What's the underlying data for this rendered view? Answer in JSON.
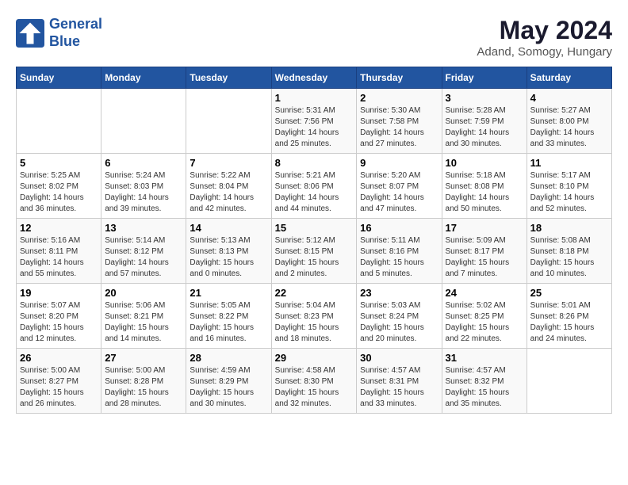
{
  "logo": {
    "line1": "General",
    "line2": "Blue"
  },
  "title": "May 2024",
  "subtitle": "Adand, Somogy, Hungary",
  "days_of_week": [
    "Sunday",
    "Monday",
    "Tuesday",
    "Wednesday",
    "Thursday",
    "Friday",
    "Saturday"
  ],
  "weeks": [
    [
      {
        "day": "",
        "info": ""
      },
      {
        "day": "",
        "info": ""
      },
      {
        "day": "",
        "info": ""
      },
      {
        "day": "1",
        "info": "Sunrise: 5:31 AM\nSunset: 7:56 PM\nDaylight: 14 hours and 25 minutes."
      },
      {
        "day": "2",
        "info": "Sunrise: 5:30 AM\nSunset: 7:58 PM\nDaylight: 14 hours and 27 minutes."
      },
      {
        "day": "3",
        "info": "Sunrise: 5:28 AM\nSunset: 7:59 PM\nDaylight: 14 hours and 30 minutes."
      },
      {
        "day": "4",
        "info": "Sunrise: 5:27 AM\nSunset: 8:00 PM\nDaylight: 14 hours and 33 minutes."
      }
    ],
    [
      {
        "day": "5",
        "info": "Sunrise: 5:25 AM\nSunset: 8:02 PM\nDaylight: 14 hours and 36 minutes."
      },
      {
        "day": "6",
        "info": "Sunrise: 5:24 AM\nSunset: 8:03 PM\nDaylight: 14 hours and 39 minutes."
      },
      {
        "day": "7",
        "info": "Sunrise: 5:22 AM\nSunset: 8:04 PM\nDaylight: 14 hours and 42 minutes."
      },
      {
        "day": "8",
        "info": "Sunrise: 5:21 AM\nSunset: 8:06 PM\nDaylight: 14 hours and 44 minutes."
      },
      {
        "day": "9",
        "info": "Sunrise: 5:20 AM\nSunset: 8:07 PM\nDaylight: 14 hours and 47 minutes."
      },
      {
        "day": "10",
        "info": "Sunrise: 5:18 AM\nSunset: 8:08 PM\nDaylight: 14 hours and 50 minutes."
      },
      {
        "day": "11",
        "info": "Sunrise: 5:17 AM\nSunset: 8:10 PM\nDaylight: 14 hours and 52 minutes."
      }
    ],
    [
      {
        "day": "12",
        "info": "Sunrise: 5:16 AM\nSunset: 8:11 PM\nDaylight: 14 hours and 55 minutes."
      },
      {
        "day": "13",
        "info": "Sunrise: 5:14 AM\nSunset: 8:12 PM\nDaylight: 14 hours and 57 minutes."
      },
      {
        "day": "14",
        "info": "Sunrise: 5:13 AM\nSunset: 8:13 PM\nDaylight: 15 hours and 0 minutes."
      },
      {
        "day": "15",
        "info": "Sunrise: 5:12 AM\nSunset: 8:15 PM\nDaylight: 15 hours and 2 minutes."
      },
      {
        "day": "16",
        "info": "Sunrise: 5:11 AM\nSunset: 8:16 PM\nDaylight: 15 hours and 5 minutes."
      },
      {
        "day": "17",
        "info": "Sunrise: 5:09 AM\nSunset: 8:17 PM\nDaylight: 15 hours and 7 minutes."
      },
      {
        "day": "18",
        "info": "Sunrise: 5:08 AM\nSunset: 8:18 PM\nDaylight: 15 hours and 10 minutes."
      }
    ],
    [
      {
        "day": "19",
        "info": "Sunrise: 5:07 AM\nSunset: 8:20 PM\nDaylight: 15 hours and 12 minutes."
      },
      {
        "day": "20",
        "info": "Sunrise: 5:06 AM\nSunset: 8:21 PM\nDaylight: 15 hours and 14 minutes."
      },
      {
        "day": "21",
        "info": "Sunrise: 5:05 AM\nSunset: 8:22 PM\nDaylight: 15 hours and 16 minutes."
      },
      {
        "day": "22",
        "info": "Sunrise: 5:04 AM\nSunset: 8:23 PM\nDaylight: 15 hours and 18 minutes."
      },
      {
        "day": "23",
        "info": "Sunrise: 5:03 AM\nSunset: 8:24 PM\nDaylight: 15 hours and 20 minutes."
      },
      {
        "day": "24",
        "info": "Sunrise: 5:02 AM\nSunset: 8:25 PM\nDaylight: 15 hours and 22 minutes."
      },
      {
        "day": "25",
        "info": "Sunrise: 5:01 AM\nSunset: 8:26 PM\nDaylight: 15 hours and 24 minutes."
      }
    ],
    [
      {
        "day": "26",
        "info": "Sunrise: 5:00 AM\nSunset: 8:27 PM\nDaylight: 15 hours and 26 minutes."
      },
      {
        "day": "27",
        "info": "Sunrise: 5:00 AM\nSunset: 8:28 PM\nDaylight: 15 hours and 28 minutes."
      },
      {
        "day": "28",
        "info": "Sunrise: 4:59 AM\nSunset: 8:29 PM\nDaylight: 15 hours and 30 minutes."
      },
      {
        "day": "29",
        "info": "Sunrise: 4:58 AM\nSunset: 8:30 PM\nDaylight: 15 hours and 32 minutes."
      },
      {
        "day": "30",
        "info": "Sunrise: 4:57 AM\nSunset: 8:31 PM\nDaylight: 15 hours and 33 minutes."
      },
      {
        "day": "31",
        "info": "Sunrise: 4:57 AM\nSunset: 8:32 PM\nDaylight: 15 hours and 35 minutes."
      },
      {
        "day": "",
        "info": ""
      }
    ]
  ]
}
